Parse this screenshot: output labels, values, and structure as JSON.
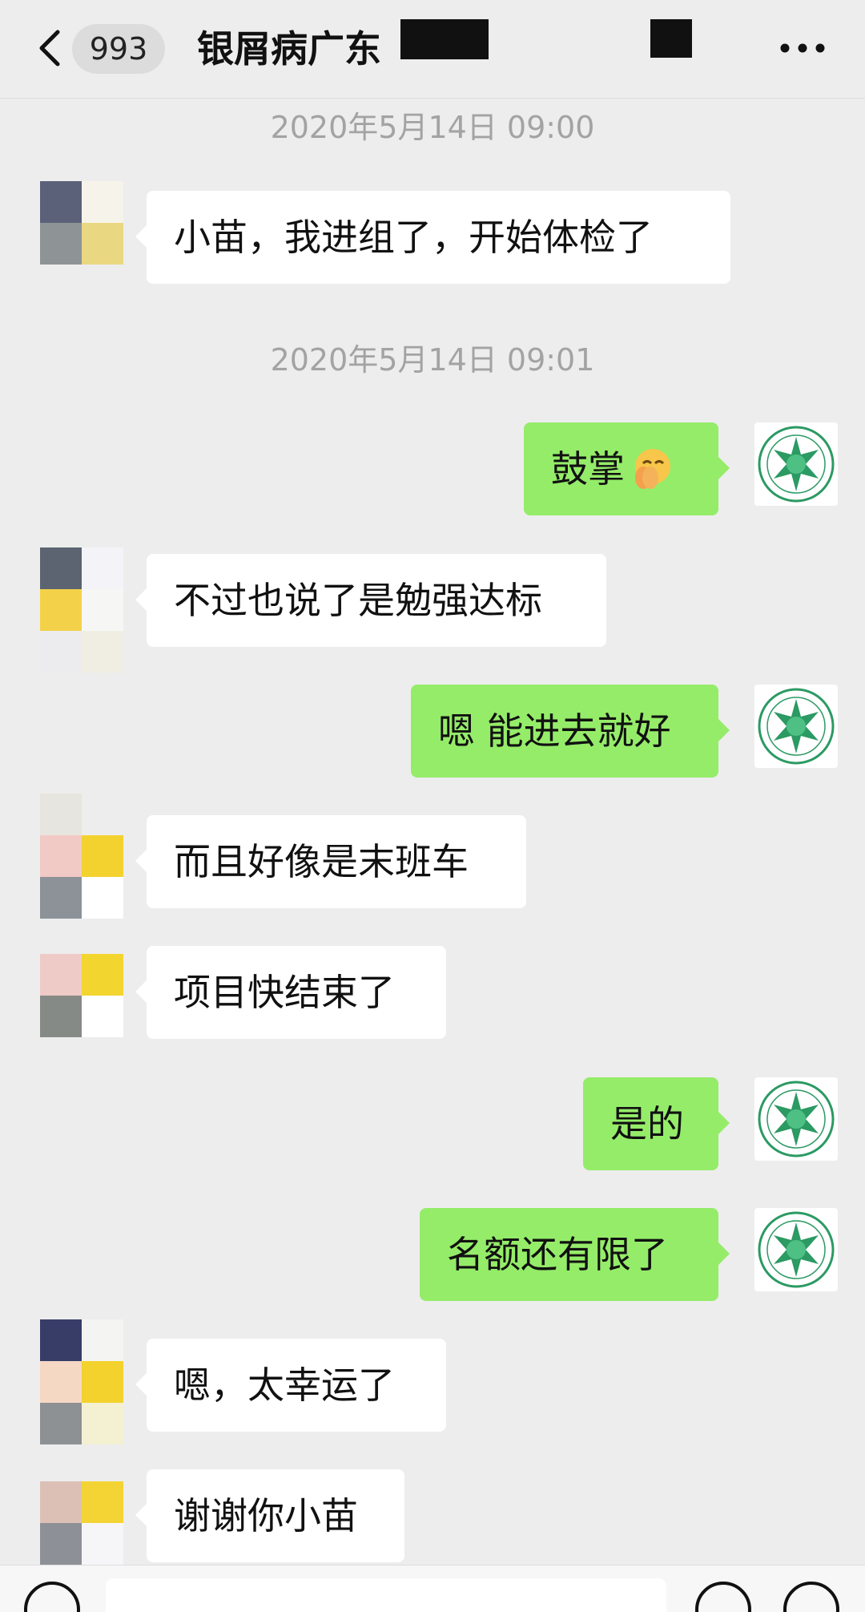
{
  "header": {
    "back_icon": "chevron-left-icon",
    "unread_count": "993",
    "title": "银屑病广东",
    "more_icon": "more-horizontal-icon"
  },
  "messages": [
    {
      "type": "timestamp",
      "text": "2020年5月14日 09:00"
    },
    {
      "type": "incoming",
      "text": "小苗，我进组了，开始体检了"
    },
    {
      "type": "timestamp",
      "text": "2020年5月14日 09:01"
    },
    {
      "type": "outgoing",
      "text": "鼓掌",
      "emoji": "hands-together-emoji"
    },
    {
      "type": "incoming",
      "text": "不过也说了是勉强达标"
    },
    {
      "type": "outgoing",
      "text": "嗯 能进去就好"
    },
    {
      "type": "incoming",
      "text": "而且好像是末班车"
    },
    {
      "type": "incoming",
      "text": "项目快结束了"
    },
    {
      "type": "outgoing",
      "text": "是的"
    },
    {
      "type": "outgoing",
      "text": "名额还有限了"
    },
    {
      "type": "incoming",
      "text": "嗯，太幸运了"
    },
    {
      "type": "incoming",
      "text": "谢谢你小苗"
    }
  ],
  "colors": {
    "background": "#ededed",
    "incoming_bubble": "#ffffff",
    "outgoing_bubble": "#95ec69",
    "timestamp_text": "#a3a3a3",
    "logo_green": "#2b9a63"
  },
  "input_bar": {
    "voice_icon": "voice-icon",
    "emoji_icon": "emoji-icon",
    "plus_icon": "plus-icon"
  }
}
